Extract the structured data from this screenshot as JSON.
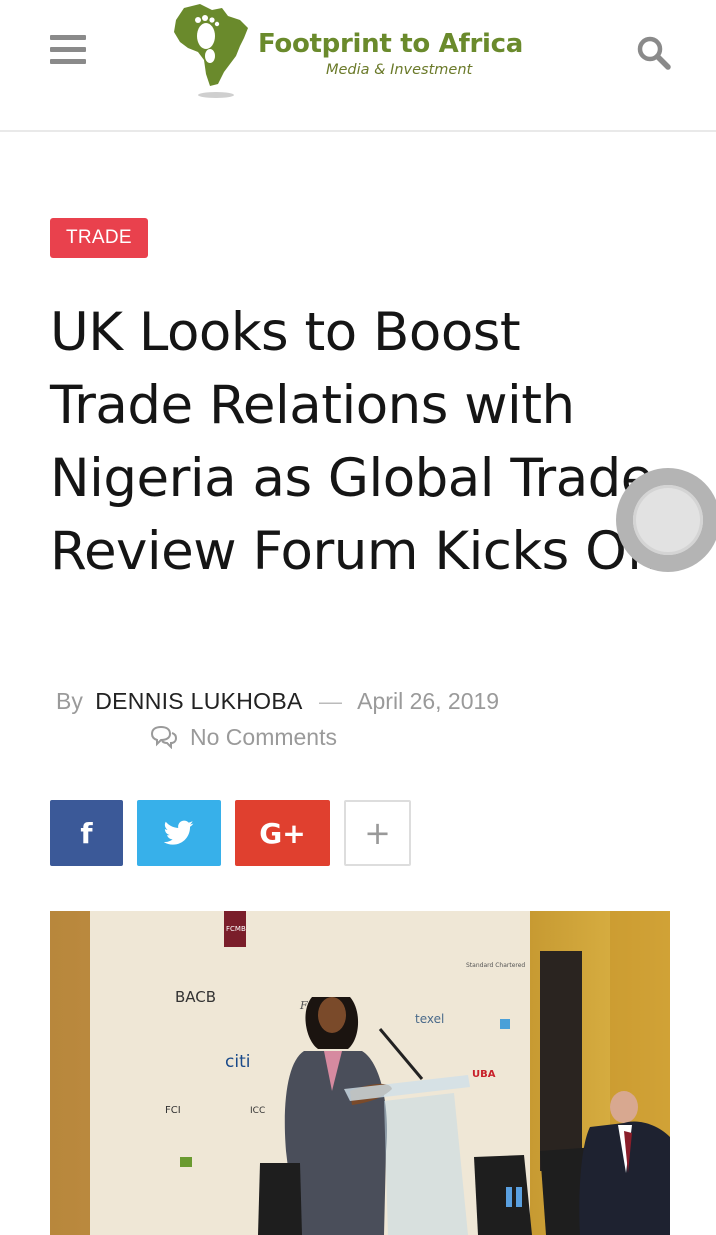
{
  "header": {
    "logo_title": "Footprint to Africa",
    "logo_subtitle": "Media & Investment",
    "menu_icon": "hamburger-menu-icon",
    "search_icon": "search-icon",
    "brand_color": "#6a8a2c"
  },
  "article": {
    "category": "TRADE",
    "category_color": "#e9414d",
    "title": "UK Looks to Boost Trade Relations with Nigeria as Global Trade Review Forum Kicks Off",
    "by_label": "By",
    "author": "DENNIS LUKHOBA",
    "separator": "—",
    "date": "April 26, 2019",
    "comments": "No Comments",
    "comments_icon": "comments-icon"
  },
  "share": {
    "facebook": {
      "label": "f",
      "icon": "facebook-icon",
      "color": "#3b5998"
    },
    "twitter": {
      "icon": "twitter-icon",
      "color": "#37b0ea"
    },
    "googleplus": {
      "label": "G+",
      "icon": "google-plus-icon",
      "color": "#e0402f"
    },
    "more": {
      "label": "+",
      "icon": "plus-icon"
    }
  },
  "featured_image": {
    "sponsor_logos": [
      "FCMB",
      "BACB",
      "First",
      "texel",
      "citi",
      "UBA",
      "FCI",
      "ICC",
      "Standard Chartered"
    ]
  }
}
